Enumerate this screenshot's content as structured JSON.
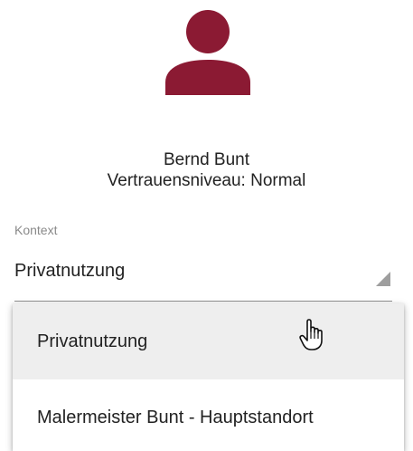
{
  "user": {
    "avatar_icon": "person-icon",
    "avatar_color": "#8b1a33",
    "name": "Bernd Bunt",
    "trust_level": "Vertrauensniveau: Normal"
  },
  "context": {
    "label": "Kontext",
    "selected_value": "Privatnutzung",
    "options": [
      {
        "label": "Privatnutzung",
        "hovered": true
      },
      {
        "label": "Malermeister Bunt - Hauptstandort",
        "hovered": false
      }
    ]
  }
}
